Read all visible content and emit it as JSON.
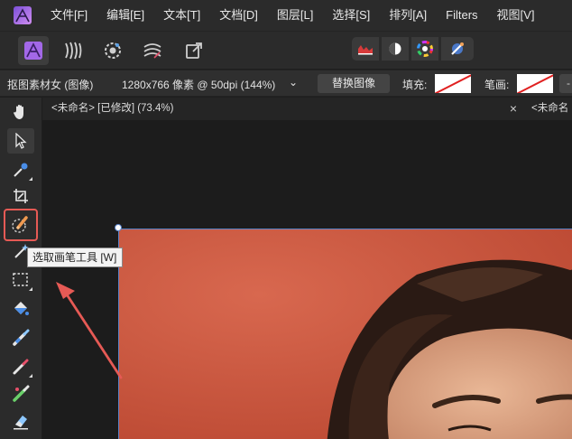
{
  "menu": {
    "items": [
      "文件[F]",
      "编辑[E]",
      "文本[T]",
      "文档[D]",
      "图层[L]",
      "选择[S]",
      "排列[A]",
      "Filters",
      "视图[V]"
    ]
  },
  "personas": [
    "photo-persona-icon",
    "liquify-persona-icon",
    "develop-persona-icon",
    "tone-mapping-persona-icon",
    "export-persona-icon"
  ],
  "studio_buttons": [
    "histogram-icon",
    "adjustments-icon",
    "color-wheel-icon",
    "brushes-icon"
  ],
  "context": {
    "layer_name": "抠图素材女 (图像)",
    "dimensions": "1280x766 像素 @ 50dpi (144%)",
    "chevron": "⌄",
    "replace_image": "替换图像",
    "fill_label": "填充:",
    "stroke_label": "笔画:"
  },
  "tabs": [
    {
      "label": "<未命名> [已修改] (73.4%)",
      "close": "×"
    },
    {
      "label": "<未命名"
    }
  ],
  "tooltip": "选取画笔工具 [W]",
  "colors": {
    "highlight": "#e65a55",
    "photo_bg": "#cf5a44",
    "affinity_purple": "#a368e8",
    "selection_blue": "#5a83c9"
  }
}
